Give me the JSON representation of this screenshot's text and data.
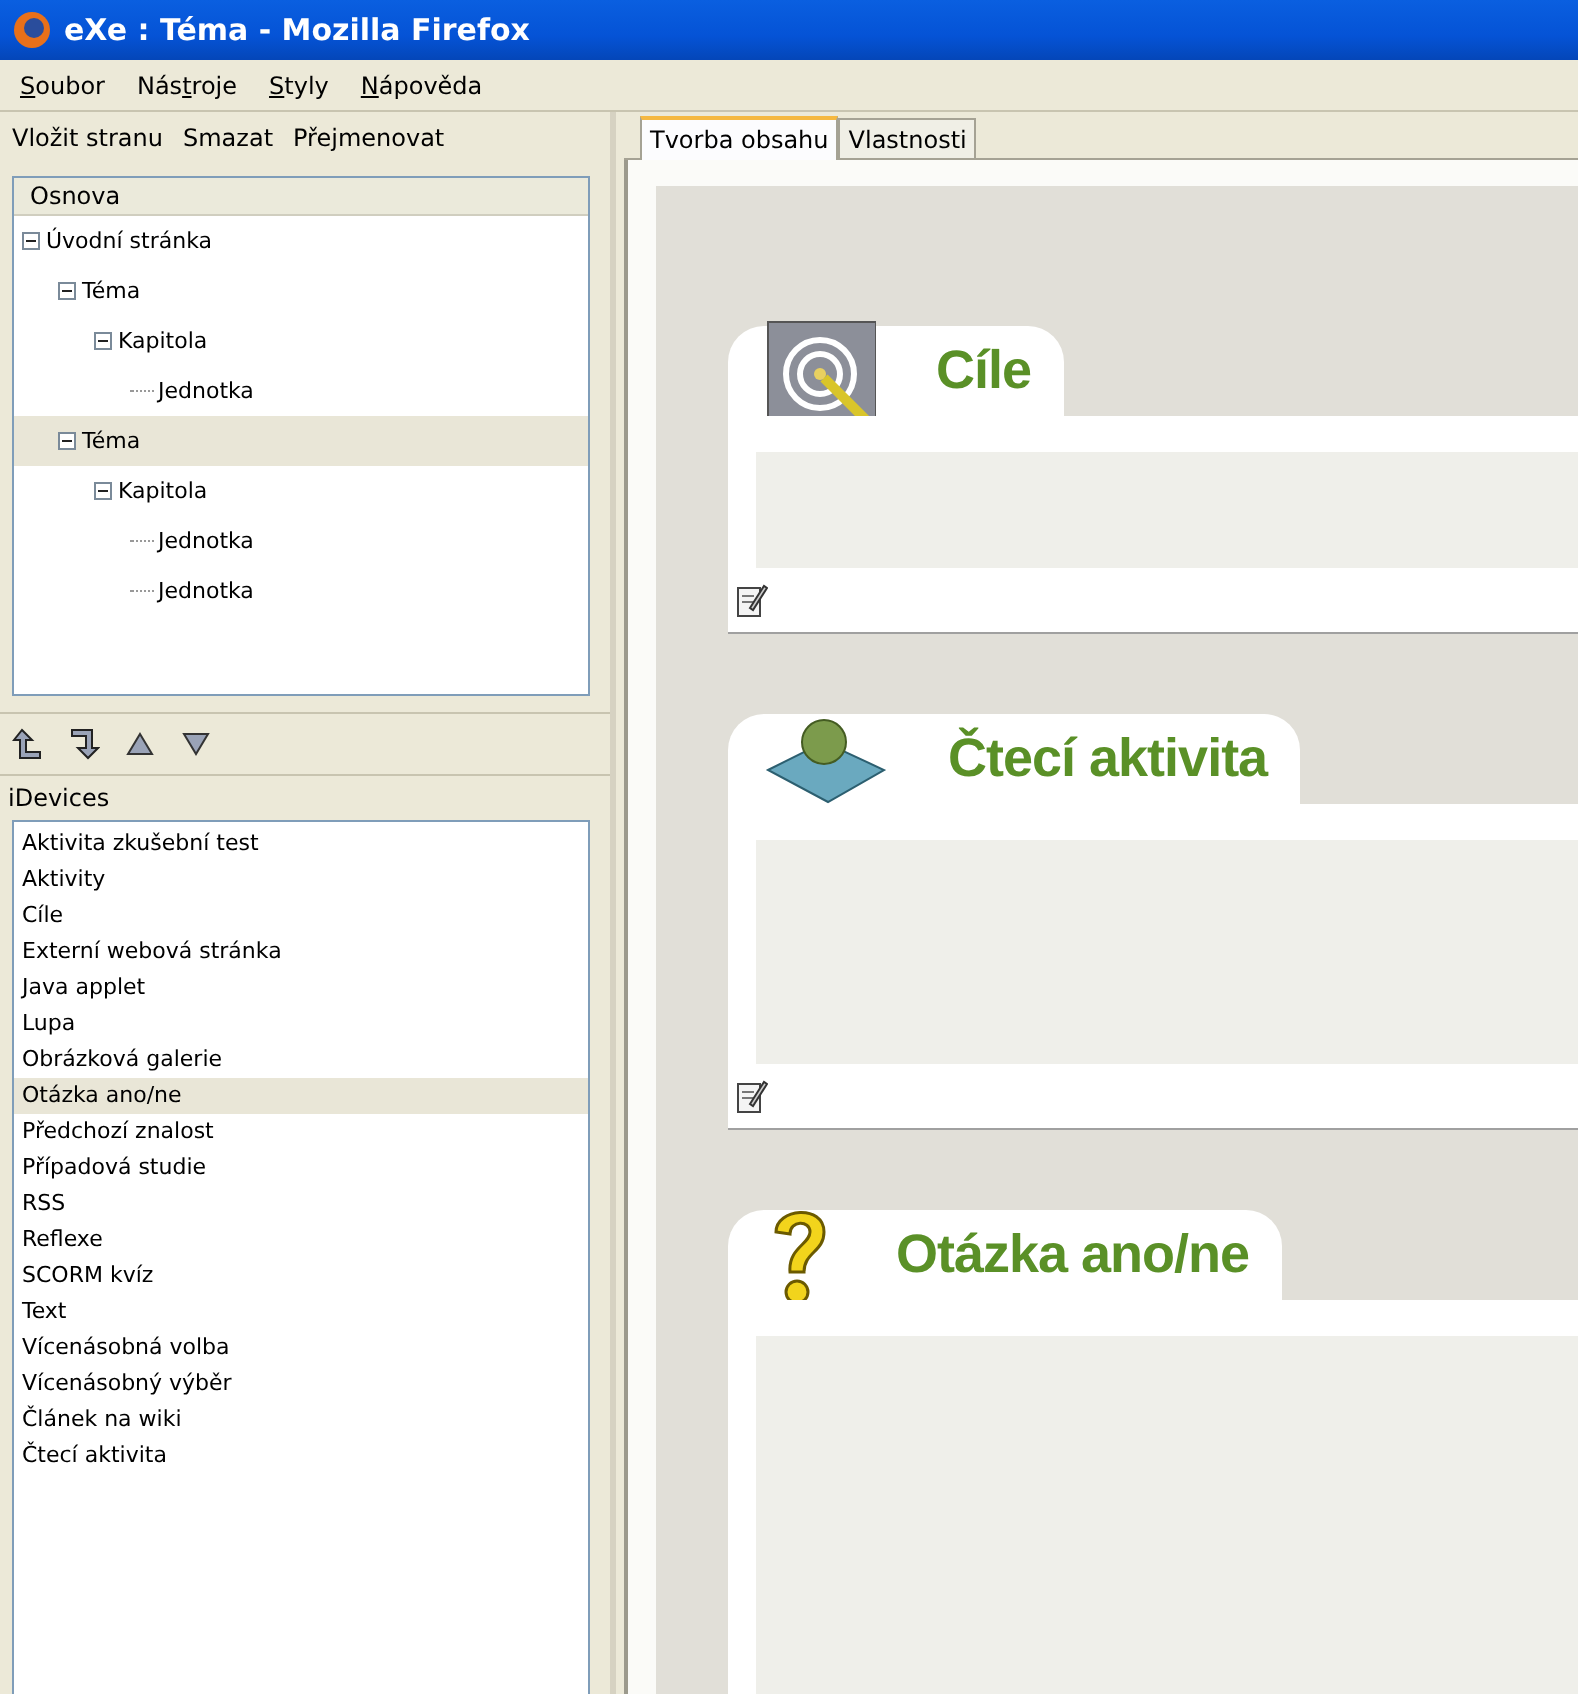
{
  "window": {
    "title": "eXe : Téma - Mozilla Firefox"
  },
  "menu": [
    {
      "key": "S",
      "after": "oubor"
    },
    {
      "before": "Nás",
      "key": "t",
      "after": "roje"
    },
    {
      "key": "S",
      "after": "tyly"
    },
    {
      "key": "N",
      "after": "ápověda"
    }
  ],
  "outline_toolbar": [
    "Vložit stranu",
    "Smazat",
    "Přejmenovat"
  ],
  "outline": {
    "header": "Osnova",
    "items": [
      {
        "label": "Úvodní stránka",
        "selected": false,
        "expanded": true,
        "children": [
          {
            "label": "Téma",
            "selected": false,
            "expanded": true,
            "children": [
              {
                "label": "Kapitola",
                "selected": false,
                "expanded": true,
                "children": [
                  {
                    "label": "Jednotka",
                    "selected": false
                  }
                ]
              }
            ]
          },
          {
            "label": "Téma",
            "selected": true,
            "expanded": true,
            "children": [
              {
                "label": "Kapitola",
                "selected": false,
                "expanded": true,
                "children": [
                  {
                    "label": "Jednotka",
                    "selected": false
                  },
                  {
                    "label": "Jednotka",
                    "selected": false
                  }
                ]
              }
            ]
          }
        ]
      }
    ]
  },
  "move_buttons": [
    {
      "kind": "promote"
    },
    {
      "kind": "demote"
    },
    {
      "kind": "up"
    },
    {
      "kind": "down"
    }
  ],
  "idevices": {
    "header": "iDevices",
    "items": [
      {
        "label": "Aktivita zkušební test",
        "selected": false
      },
      {
        "label": "Aktivity",
        "selected": false
      },
      {
        "label": "Cíle",
        "selected": false
      },
      {
        "label": "Externí webová stránka",
        "selected": false
      },
      {
        "label": "Java applet",
        "selected": false
      },
      {
        "label": "Lupa",
        "selected": false
      },
      {
        "label": "Obrázková galerie",
        "selected": false
      },
      {
        "label": "Otázka ano/ne",
        "selected": true
      },
      {
        "label": "Předchozí znalost",
        "selected": false
      },
      {
        "label": "Případová studie",
        "selected": false
      },
      {
        "label": "RSS",
        "selected": false
      },
      {
        "label": "Reflexe",
        "selected": false
      },
      {
        "label": "SCORM kvíz",
        "selected": false
      },
      {
        "label": "Text",
        "selected": false
      },
      {
        "label": "Vícenásobná volba",
        "selected": false
      },
      {
        "label": "Vícenásobný výběr",
        "selected": false
      },
      {
        "label": "Článek na wiki",
        "selected": false
      },
      {
        "label": "Čtecí aktivita",
        "selected": false
      }
    ]
  },
  "tabs": [
    {
      "label": "Tvorba obsahu",
      "selected": true
    },
    {
      "label": "Vlastnosti",
      "selected": false
    }
  ],
  "blocks": [
    {
      "kind": "objectives",
      "title": "Cíle",
      "edit_icon": true
    },
    {
      "kind": "reading",
      "title": "Čtecí aktivita",
      "edit_icon": true
    },
    {
      "kind": "question",
      "title": "Otázka ano/ne",
      "edit_icon": false
    }
  ]
}
